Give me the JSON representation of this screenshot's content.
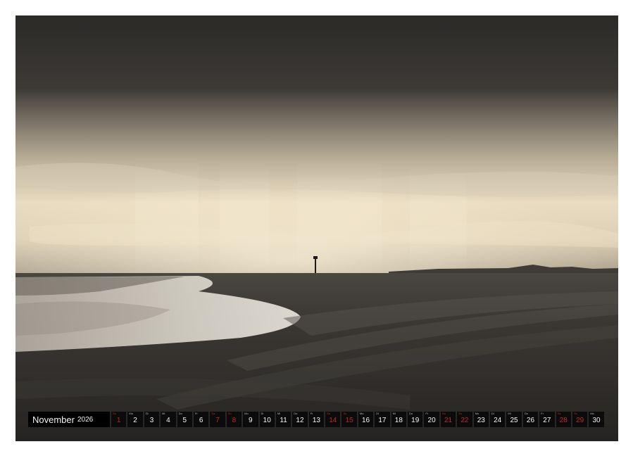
{
  "calendar": {
    "month": "November",
    "year": "2026",
    "days": [
      {
        "wd": "So",
        "num": "1",
        "red": true
      },
      {
        "wd": "Mo",
        "num": "2",
        "red": false
      },
      {
        "wd": "Di",
        "num": "3",
        "red": false
      },
      {
        "wd": "Mi",
        "num": "4",
        "red": false
      },
      {
        "wd": "Do",
        "num": "5",
        "red": false
      },
      {
        "wd": "Fr",
        "num": "6",
        "red": false
      },
      {
        "wd": "Sa",
        "num": "7",
        "red": true
      },
      {
        "wd": "So",
        "num": "8",
        "red": true
      },
      {
        "wd": "Mo",
        "num": "9",
        "red": false
      },
      {
        "wd": "Di",
        "num": "10",
        "red": false
      },
      {
        "wd": "Mi",
        "num": "11",
        "red": false
      },
      {
        "wd": "Do",
        "num": "12",
        "red": false
      },
      {
        "wd": "Fr",
        "num": "13",
        "red": false
      },
      {
        "wd": "Sa",
        "num": "14",
        "red": true
      },
      {
        "wd": "So",
        "num": "15",
        "red": true
      },
      {
        "wd": "Mo",
        "num": "16",
        "red": false
      },
      {
        "wd": "Di",
        "num": "17",
        "red": false
      },
      {
        "wd": "Mi",
        "num": "18",
        "red": false
      },
      {
        "wd": "Do",
        "num": "19",
        "red": false
      },
      {
        "wd": "Fr",
        "num": "20",
        "red": false
      },
      {
        "wd": "Sa",
        "num": "21",
        "red": true
      },
      {
        "wd": "So",
        "num": "22",
        "red": true
      },
      {
        "wd": "Mo",
        "num": "23",
        "red": false
      },
      {
        "wd": "Di",
        "num": "24",
        "red": false
      },
      {
        "wd": "Mi",
        "num": "25",
        "red": false
      },
      {
        "wd": "Do",
        "num": "26",
        "red": false
      },
      {
        "wd": "Fr",
        "num": "27",
        "red": false
      },
      {
        "wd": "Sa",
        "num": "28",
        "red": true
      },
      {
        "wd": "So",
        "num": "29",
        "red": true
      },
      {
        "wd": "Mo",
        "num": "30",
        "red": false
      }
    ]
  },
  "colors": {
    "weekend": "#c3271d",
    "cell_bg": "#0b0b0b",
    "page_bg": "#ffffff"
  },
  "icons": {
    "binding": "wire-binding-icon"
  }
}
